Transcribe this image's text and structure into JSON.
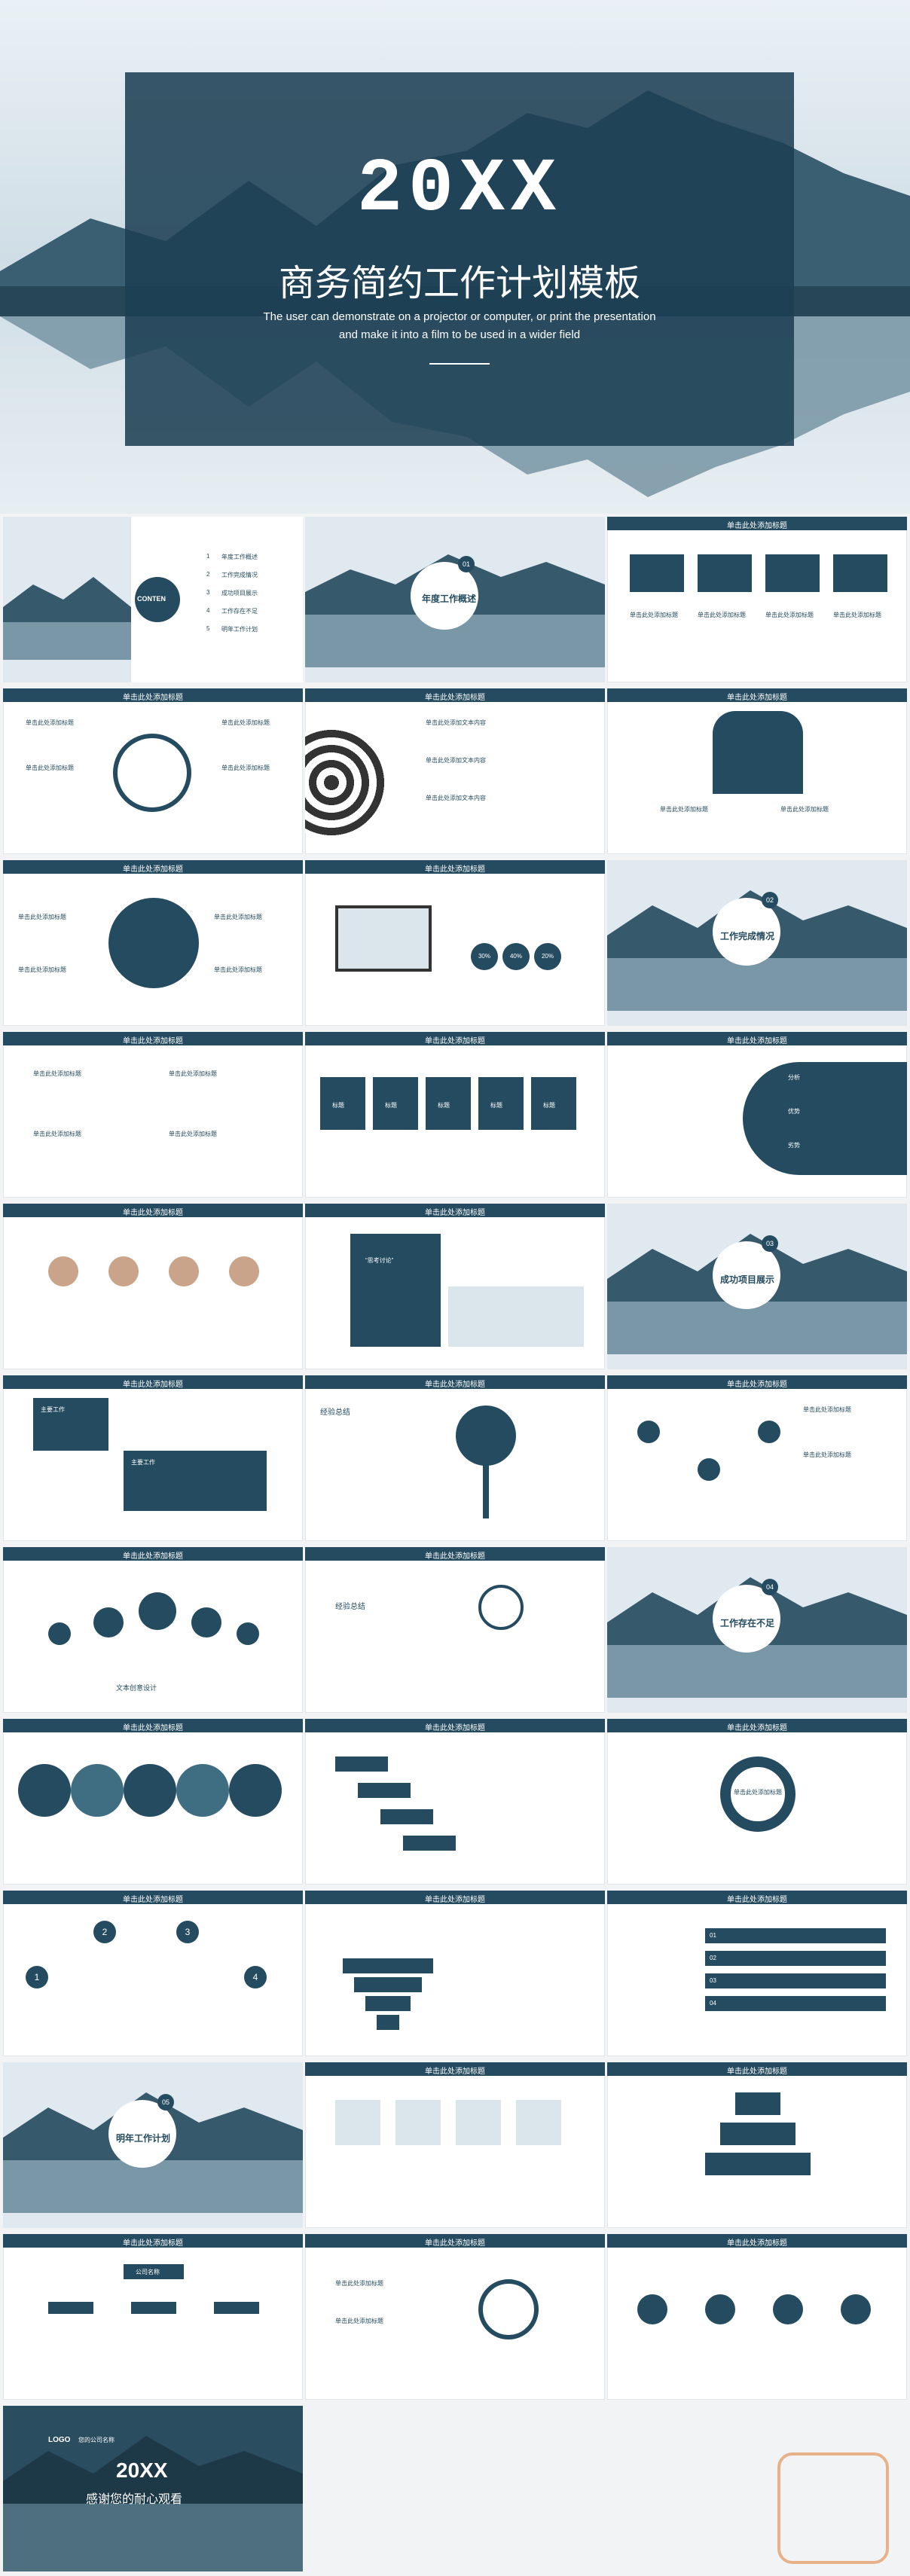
{
  "hero": {
    "title": "20XX",
    "subtitle": "商务简约工作计划模板",
    "line1": "The user can demonstrate on a projector or computer, or print the presentation",
    "line2": "and make it into a film to be used in a wider field"
  },
  "common": {
    "header": "单击此处添加标题",
    "placeholder_title": "单击此处添加标题",
    "placeholder_text": "单击此处添加文本内容",
    "label_title": "标题"
  },
  "toc": {
    "conten": "CONTEN",
    "items": [
      "年度工作概述",
      "工作完成情况",
      "成功项目展示",
      "工作存在不足",
      "明年工作计划"
    ],
    "numbers": [
      "1",
      "2",
      "3",
      "4",
      "5"
    ]
  },
  "sections": {
    "s1": {
      "num": "01",
      "title": "年度工作概述"
    },
    "s2": {
      "num": "02",
      "title": "工作完成情况"
    },
    "s3": {
      "num": "03",
      "title": "成功项目展示"
    },
    "s4": {
      "num": "04",
      "title": "工作存在不足"
    },
    "s5": {
      "num": "05",
      "title": "明年工作计划"
    }
  },
  "texts": {
    "star_caption": "文本创意设计",
    "exp_summary": "经验总结",
    "org": "公司名称",
    "percentages": [
      "30%",
      "40%",
      "20%"
    ],
    "main_work1": "主要工作",
    "main_work2": "主要工作",
    "analysis": [
      "分析",
      "优势",
      "劣势"
    ],
    "pie_center": "单击此处添加标题",
    "numbers_1234": [
      "1",
      "2",
      "3",
      "4"
    ],
    "bars": [
      "01",
      "02",
      "03",
      "04"
    ],
    "left_quote": "“思考讨论”"
  },
  "closing": {
    "logo": "LOGO",
    "company": "您的公司名称",
    "title": "20XX",
    "subtitle": "感谢您的耐心观看"
  },
  "colors": {
    "primary": "#244b5f",
    "light": "#dbe6ec",
    "accent": "#e7b189"
  },
  "icons": {
    "watermark": "p-logo-icon"
  }
}
